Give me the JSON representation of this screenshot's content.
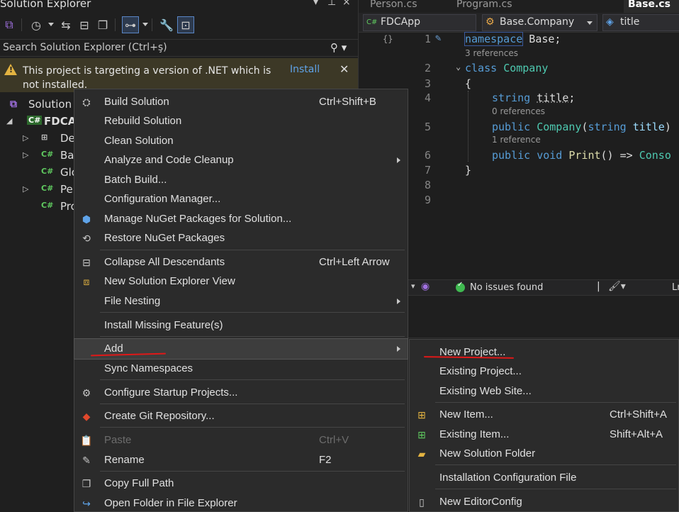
{
  "solution_explorer": {
    "title": "Solution Explorer",
    "title_controls": [
      "▾",
      "⊥",
      "×"
    ],
    "search_placeholder": "Search Solution Explorer (Ctrl+ş)",
    "warning_text": "This project is targeting a version of .NET which is not installed.",
    "warning_action": "Install",
    "solution_label": "Solution '",
    "project_label": "FDCAp",
    "tree_items": [
      {
        "label": "De",
        "icon": "dependencies-icon"
      },
      {
        "label": "Ba",
        "icon": "csharp-file-icon"
      },
      {
        "label": "Glo",
        "icon": "csharp-file-icon"
      },
      {
        "label": "Per",
        "icon": "csharp-file-icon"
      },
      {
        "label": "Pro",
        "icon": "csharp-file-icon"
      }
    ]
  },
  "editor": {
    "tabs": [
      {
        "label": "Person.cs",
        "active": false
      },
      {
        "label": "Program.cs",
        "active": false
      },
      {
        "label": "Base.cs",
        "active": true
      }
    ],
    "nav": {
      "project": "FDCApp",
      "type": "Base.Company",
      "member": "title"
    },
    "line_numbers": [
      "1",
      "2",
      "3",
      "4",
      "5",
      "6",
      "7",
      "8",
      "9"
    ],
    "code": {
      "l1_kw": "namespace",
      "l1_rest": " Base;",
      "l1_ref": "3 references",
      "l2_kw": "class",
      "l2_name": "Company",
      "l3": "{",
      "l4_kw": "string",
      "l4_id": "title",
      "l4_end": ";",
      "l4_ref": "0 references",
      "l5_kw": "public",
      "l5_fn": "Company",
      "l5_p": "(",
      "l5_pt": "string",
      "l5_pn": "title",
      "l5_end": ")",
      "l5_ref": "1 reference",
      "l6_kw1": "public",
      "l6_kw2": "void",
      "l6_fn": "Print",
      "l6_rest": "() => ",
      "l6_ty": "Conso",
      "l7": "}"
    },
    "status_text": "No issues found",
    "status_right": "Ln"
  },
  "context_menu": {
    "items": [
      {
        "label": "Build Solution",
        "shortcut": "Ctrl+Shift+B",
        "icon": "build-icon"
      },
      {
        "label": "Rebuild Solution",
        "shortcut": "",
        "icon": ""
      },
      {
        "label": "Clean Solution",
        "shortcut": "",
        "icon": ""
      },
      {
        "label": "Analyze and Code Cleanup",
        "shortcut": "",
        "icon": ""
      },
      {
        "label": "Batch Build...",
        "shortcut": "",
        "icon": ""
      },
      {
        "label": "Configuration Manager...",
        "shortcut": "",
        "icon": ""
      },
      {
        "label": "Manage NuGet Packages for Solution...",
        "shortcut": "",
        "icon": "nuget-icon"
      },
      {
        "label": "Restore NuGet Packages",
        "shortcut": "",
        "icon": "restore-icon"
      },
      {
        "label": "Collapse All Descendants",
        "shortcut": "Ctrl+Left Arrow",
        "icon": "collapse-icon"
      },
      {
        "label": "New Solution Explorer View",
        "shortcut": "",
        "icon": "new-view-icon"
      },
      {
        "label": "File Nesting",
        "shortcut": "",
        "icon": ""
      },
      {
        "label": "Install Missing Feature(s)",
        "shortcut": "",
        "icon": ""
      },
      {
        "label": "Add",
        "shortcut": "",
        "icon": ""
      },
      {
        "label": "Sync Namespaces",
        "shortcut": "",
        "icon": ""
      },
      {
        "label": "Configure Startup Projects...",
        "shortcut": "",
        "icon": "gear-icon"
      },
      {
        "label": "Create Git Repository...",
        "shortcut": "",
        "icon": "git-icon"
      },
      {
        "label": "Paste",
        "shortcut": "Ctrl+V",
        "icon": "paste-icon"
      },
      {
        "label": "Rename",
        "shortcut": "F2",
        "icon": "rename-icon"
      },
      {
        "label": "Copy Full Path",
        "shortcut": "",
        "icon": "copy-icon"
      },
      {
        "label": "Open Folder in File Explorer",
        "shortcut": "",
        "icon": "open-folder-icon"
      }
    ]
  },
  "submenu": {
    "items": [
      {
        "label": "New Project...",
        "shortcut": "",
        "icon": ""
      },
      {
        "label": "Existing Project...",
        "shortcut": "",
        "icon": ""
      },
      {
        "label": "Existing Web Site...",
        "shortcut": "",
        "icon": ""
      },
      {
        "label": "New Item...",
        "shortcut": "Ctrl+Shift+A",
        "icon": "new-item-icon"
      },
      {
        "label": "Existing Item...",
        "shortcut": "Shift+Alt+A",
        "icon": "existing-item-icon"
      },
      {
        "label": "New Solution Folder",
        "shortcut": "",
        "icon": "new-folder-icon"
      },
      {
        "label": "Installation Configuration File",
        "shortcut": "",
        "icon": ""
      },
      {
        "label": "New EditorConfig",
        "shortcut": "",
        "icon": "editorconfig-icon"
      }
    ]
  },
  "colors": {
    "annotation_red": "#e01818",
    "keyword": "#569cd6",
    "type": "#4ec9b0",
    "method": "#dcdcaa"
  }
}
